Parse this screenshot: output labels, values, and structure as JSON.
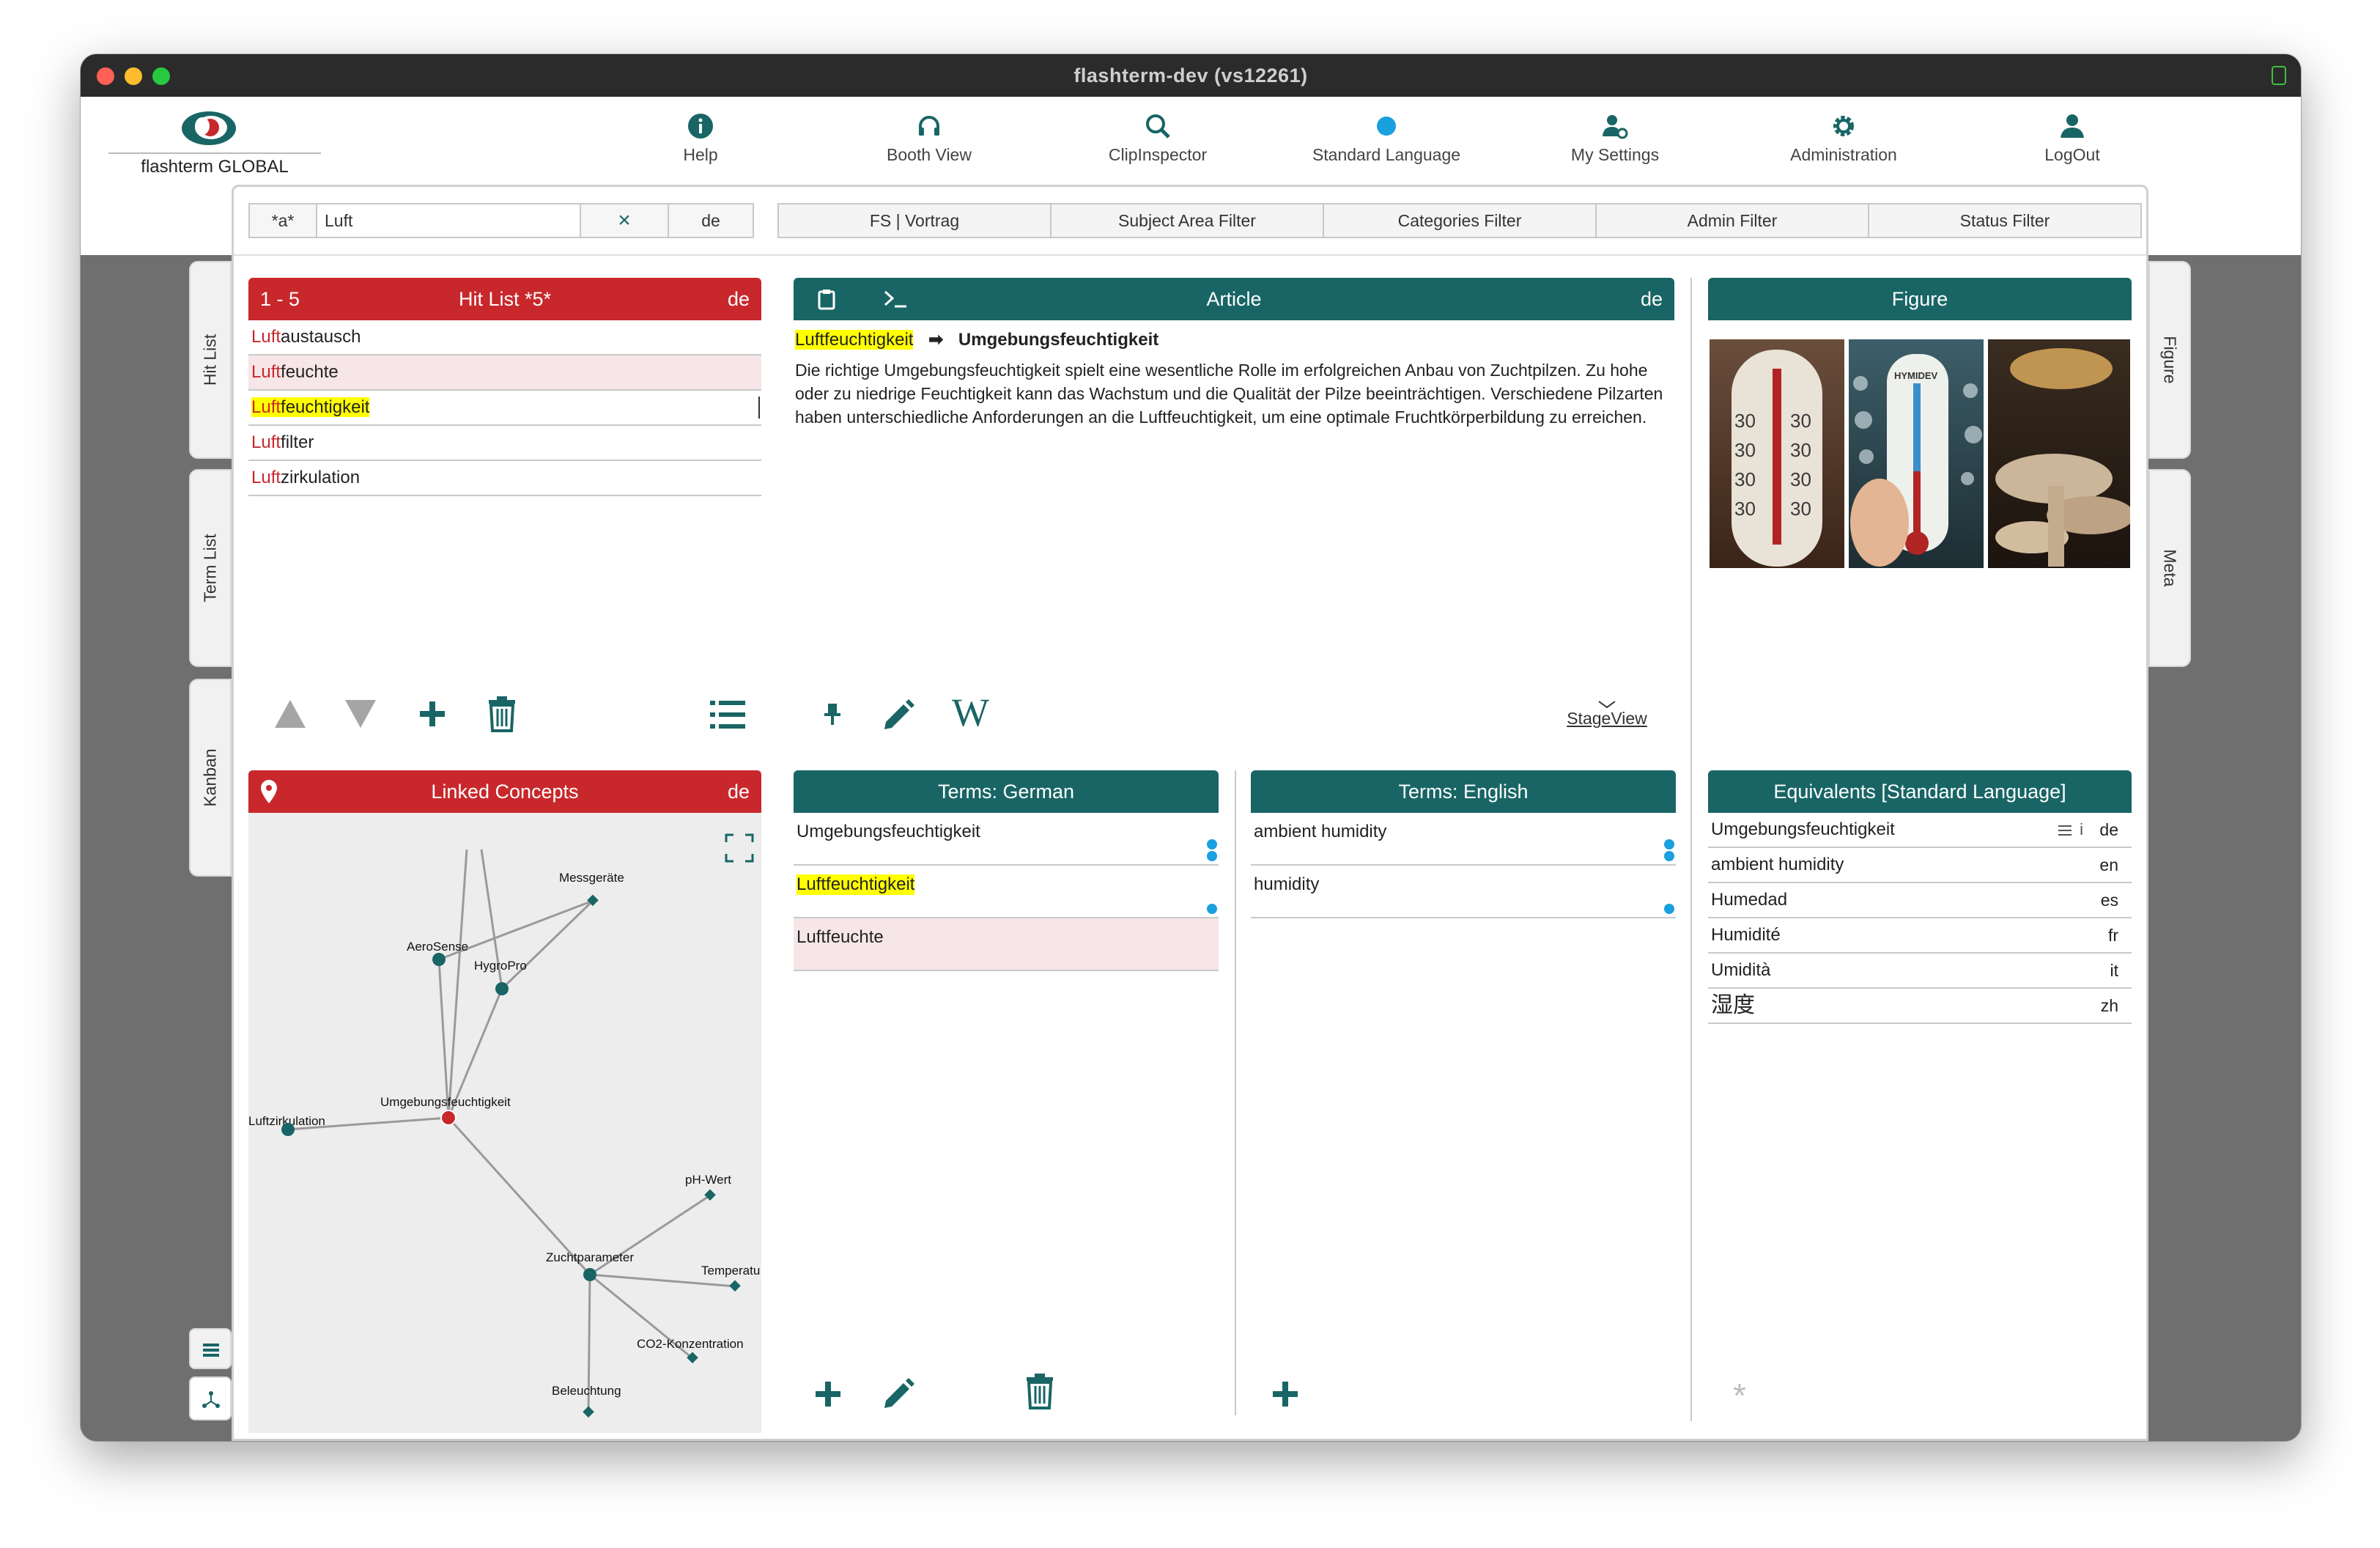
{
  "window": {
    "title": "flashterm-dev (vs12261)"
  },
  "logo": {
    "text": "flashterm GLOBAL"
  },
  "nav": [
    {
      "label": "Help",
      "icon": "info-icon"
    },
    {
      "label": "Booth View",
      "icon": "headset-icon"
    },
    {
      "label": "ClipInspector",
      "icon": "search-icon"
    },
    {
      "label": "Standard Language",
      "icon": "blue-dot-icon"
    },
    {
      "label": "My Settings",
      "icon": "user-settings-icon"
    },
    {
      "label": "Administration",
      "icon": "gear-icon"
    },
    {
      "label": "LogOut",
      "icon": "user-icon"
    }
  ],
  "search": {
    "wildcard": "*a*",
    "query": "Luft",
    "clear": "×",
    "lang": "de"
  },
  "filters": [
    "FS | Vortrag",
    "Subject Area Filter",
    "Categories Filter",
    "Admin Filter",
    "Status Filter"
  ],
  "side_tabs": {
    "left": [
      "Hit List",
      "Term List",
      "Kanban"
    ],
    "right": [
      "Figure",
      "Meta"
    ]
  },
  "hitlist": {
    "range": "1 - 5",
    "title": "Hit List *5*",
    "lang": "de",
    "items": [
      {
        "prefix": "Luft",
        "rest": "austausch"
      },
      {
        "prefix": "Luft",
        "rest": "feuchte"
      },
      {
        "prefix": "Luft",
        "rest": "feuchtigkeit"
      },
      {
        "prefix": "Luft",
        "rest": "filter"
      },
      {
        "prefix": "Luft",
        "rest": "zirkulation"
      }
    ]
  },
  "linked": {
    "title": "Linked Concepts",
    "lang": "de",
    "nodes": {
      "messgeraete": "Messgeräte",
      "aerosense": "AeroSense",
      "hygropro": "HygroPro",
      "umgebung": "Umgebungsfeuchtigkeit",
      "luftzirkulation": "Luftzirkulation",
      "phwert": "pH-Wert",
      "zuchtparameter": "Zuchtparameter",
      "temperatur": "Temperatu",
      "co2": "CO2-Konzentration",
      "beleuchtung": "Beleuchtung"
    }
  },
  "article": {
    "title": "Article",
    "lang": "de",
    "source": "Luftfeuchtigkeit",
    "arrow": "➡",
    "target": "Umgebungsfeuchtigkeit",
    "body": "Die richtige Umgebungsfeuchtigkeit spielt eine wesentliche Rolle im erfolgreichen Anbau von Zuchtpilzen. Zu hohe oder zu niedrige Feuchtigkeit kann das Wachstum und die Qualität der Pilze beeinträchtigen. Verschiedene Pilzarten haben unterschiedliche Anforderungen an die Luftfeuchtigkeit, um eine optimale Fruchtkörperbildung zu erreichen.",
    "stageview": "StageView",
    "wiki": "W"
  },
  "figure": {
    "title": "Figure",
    "thermo_brand": "HYMIDEV"
  },
  "terms_de": {
    "title": "Terms:  German",
    "items": [
      "Umgebungsfeuchtigkeit",
      "Luftfeuchtigkeit",
      "Luftfeuchte"
    ]
  },
  "terms_en": {
    "title": "Terms:  English",
    "items": [
      "ambient humidity",
      "humidity"
    ]
  },
  "equivalents": {
    "title": "Equivalents [Standard Language]",
    "info_mark": "i",
    "items": [
      {
        "term": "Umgebungsfeuchtigkeit",
        "lang": "de"
      },
      {
        "term": "ambient humidity",
        "lang": "en"
      },
      {
        "term": "Humedad",
        "lang": "es"
      },
      {
        "term": "Humidité",
        "lang": "fr"
      },
      {
        "term": "Umidità",
        "lang": "it"
      },
      {
        "term": "湿度",
        "lang": "zh"
      }
    ],
    "asterisk": "*"
  },
  "colors": {
    "red": "#c8282c",
    "teal": "#196565",
    "highlight": "#ffff00",
    "dot_blue": "#1a9fdf"
  }
}
